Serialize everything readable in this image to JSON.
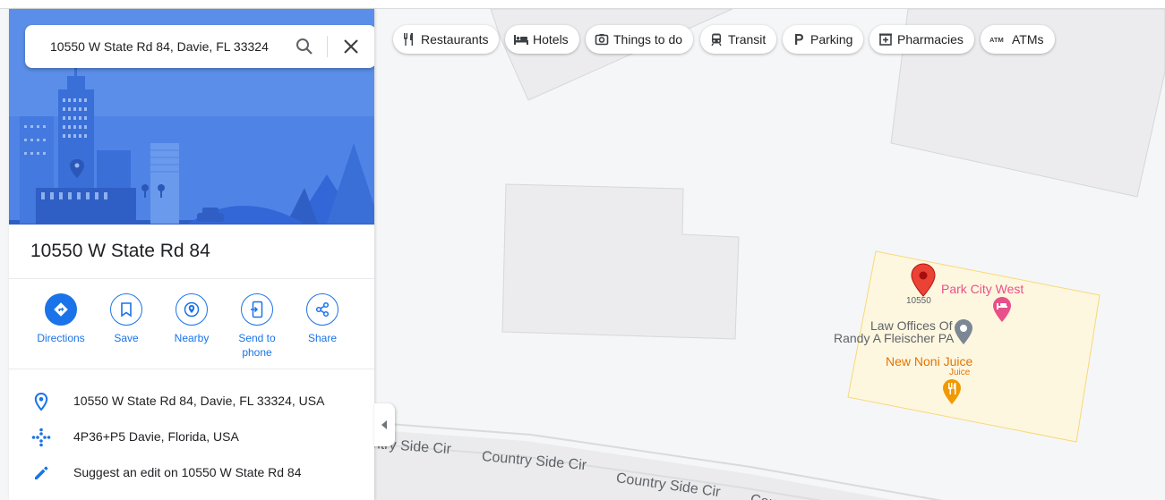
{
  "search": {
    "value": "10550 W State Rd 84, Davie, FL 33324"
  },
  "place": {
    "title": "10550 W State Rd 84"
  },
  "actions": [
    {
      "label": "Directions",
      "icon": "directions-icon"
    },
    {
      "label": "Save",
      "icon": "bookmark-icon"
    },
    {
      "label": "Nearby",
      "icon": "nearby-icon"
    },
    {
      "label": "Send to phone",
      "icon": "send-to-phone-icon"
    },
    {
      "label": "Share",
      "icon": "share-icon"
    }
  ],
  "info": [
    {
      "text": "10550 W State Rd 84, Davie, FL 33324, USA",
      "icon": "location-pin-icon"
    },
    {
      "text": "4P36+P5 Davie, Florida, USA",
      "icon": "plus-code-icon"
    },
    {
      "text": "Suggest an edit on 10550 W State Rd 84",
      "icon": "pencil-icon"
    }
  ],
  "chips": [
    {
      "label": "Restaurants",
      "icon": "restaurant-icon"
    },
    {
      "label": "Hotels",
      "icon": "hotel-icon"
    },
    {
      "label": "Things to do",
      "icon": "camera-icon"
    },
    {
      "label": "Transit",
      "icon": "train-icon"
    },
    {
      "label": "Parking",
      "icon": "parking-icon"
    },
    {
      "label": "Pharmacies",
      "icon": "pharmacy-icon"
    },
    {
      "label": "ATMs",
      "icon": "atm-icon"
    }
  ],
  "map": {
    "pin_label": "10550",
    "pois": {
      "park_city_west": "Park City West",
      "law_offices_line1": "Law Offices Of",
      "law_offices_line2": "Randy A Fleischer PA",
      "new_noni": "New Noni Juice",
      "new_noni_sub": "Juice"
    },
    "roads": {
      "r1": "ntry Side Cir",
      "r2": "Country Side Cir",
      "r3": "Country Side Cir",
      "r4": "Countr"
    }
  },
  "colors": {
    "accent": "#1a73e8",
    "pin_red": "#ea4335",
    "hotel_pink": "#e8508a",
    "food_orange": "#e37400",
    "poi_gray": "#5f6368",
    "highlight_area": "#fef7e0"
  }
}
